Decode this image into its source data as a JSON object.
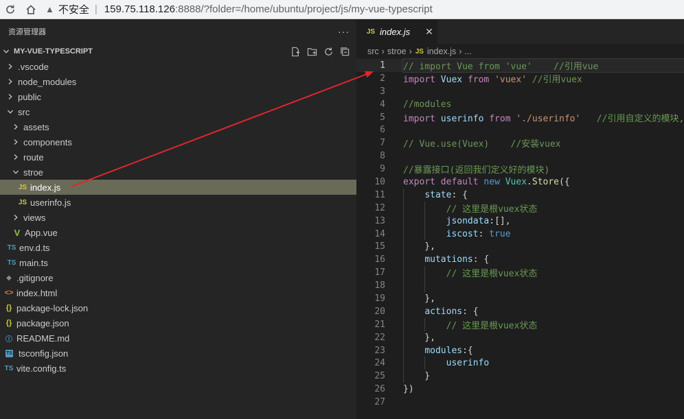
{
  "browser": {
    "warning_text": "不安全",
    "separator": "|",
    "url_host": "159.75.118.126",
    "url_rest": ":8888/?folder=/home/ubuntu/project/js/my-vue-typescript"
  },
  "explorer": {
    "title": "资源管理器",
    "more": "···",
    "project": "MY-VUE-TYPESCRIPT",
    "items": [
      {
        "label": ".vscode",
        "type": "folder",
        "expanded": false,
        "indent": 0
      },
      {
        "label": "node_modules",
        "type": "folder",
        "expanded": false,
        "indent": 0
      },
      {
        "label": "public",
        "type": "folder",
        "expanded": false,
        "indent": 0
      },
      {
        "label": "src",
        "type": "folder",
        "expanded": true,
        "indent": 0
      },
      {
        "label": "assets",
        "type": "folder",
        "expanded": false,
        "indent": 1
      },
      {
        "label": "components",
        "type": "folder",
        "expanded": false,
        "indent": 1
      },
      {
        "label": "route",
        "type": "folder",
        "expanded": false,
        "indent": 1
      },
      {
        "label": "stroe",
        "type": "folder",
        "expanded": true,
        "indent": 1
      },
      {
        "label": "index.js",
        "type": "js",
        "indent": 2,
        "selected": true
      },
      {
        "label": "userinfo.js",
        "type": "js",
        "indent": 2
      },
      {
        "label": "views",
        "type": "folder",
        "expanded": false,
        "indent": 1
      },
      {
        "label": "App.vue",
        "type": "vue",
        "indent": 1
      },
      {
        "label": "env.d.ts",
        "type": "ts",
        "indent": 0
      },
      {
        "label": "main.ts",
        "type": "ts",
        "indent": 0
      },
      {
        "label": ".gitignore",
        "type": "git",
        "indent": -1
      },
      {
        "label": "index.html",
        "type": "html",
        "indent": -1
      },
      {
        "label": "package-lock.json",
        "type": "json",
        "indent": -1
      },
      {
        "label": "package.json",
        "type": "json",
        "indent": -1
      },
      {
        "label": "README.md",
        "type": "info",
        "indent": -1
      },
      {
        "label": "tsconfig.json",
        "type": "tscfg",
        "indent": -1
      },
      {
        "label": "vite.config.ts",
        "type": "ts",
        "indent": -1
      }
    ]
  },
  "editor": {
    "tab_label": "index.js",
    "tab_icon": "JS",
    "breadcrumb": [
      "src",
      "stroe",
      "index.js",
      "..."
    ],
    "current_line": 1,
    "lines": [
      [
        [
          "// import Vue from 'vue'    //引用vue",
          "cm"
        ]
      ],
      [
        [
          "import",
          "kw"
        ],
        [
          " Vuex ",
          "prop"
        ],
        [
          "from",
          "kw"
        ],
        [
          " ",
          "pl"
        ],
        [
          "'vuex'",
          "str"
        ],
        [
          " //引用vuex",
          "cm"
        ]
      ],
      [],
      [
        [
          "//modules",
          "cm"
        ]
      ],
      [
        [
          "import",
          "kw"
        ],
        [
          " userinfo ",
          "prop"
        ],
        [
          "from",
          "kw"
        ],
        [
          " ",
          "pl"
        ],
        [
          "'./userinfo'",
          "str"
        ],
        [
          "   //引用自定义的模块,",
          "cm"
        ]
      ],
      [],
      [
        [
          "// Vue.use(Vuex)    //安装vuex",
          "cm"
        ]
      ],
      [],
      [
        [
          "//暴露接口(返回我们定义好的模块)",
          "cm"
        ]
      ],
      [
        [
          "export",
          "kw"
        ],
        [
          " ",
          "pl"
        ],
        [
          "default",
          "kw"
        ],
        [
          " ",
          "pl"
        ],
        [
          "new",
          "kw2"
        ],
        [
          " ",
          "pl"
        ],
        [
          "Vuex",
          "cls"
        ],
        [
          ".",
          "pl"
        ],
        [
          "Store",
          "fn"
        ],
        [
          "({",
          "pl"
        ]
      ],
      [
        [
          "    ",
          "pl"
        ],
        [
          "state",
          "prop"
        ],
        [
          ": {",
          "pl"
        ]
      ],
      [
        [
          "        ",
          "pl"
        ],
        [
          "// 这里是根vuex状态",
          "cm"
        ]
      ],
      [
        [
          "        ",
          "pl"
        ],
        [
          "jsondata",
          "prop"
        ],
        [
          ":[],",
          "pl"
        ]
      ],
      [
        [
          "        ",
          "pl"
        ],
        [
          "iscost",
          "prop"
        ],
        [
          ": ",
          "pl"
        ],
        [
          "true",
          "kw2"
        ]
      ],
      [
        [
          "    },",
          "pl"
        ]
      ],
      [
        [
          "    ",
          "pl"
        ],
        [
          "mutations",
          "prop"
        ],
        [
          ": {",
          "pl"
        ]
      ],
      [
        [
          "        ",
          "pl"
        ],
        [
          "// 这里是根vuex状态",
          "cm"
        ]
      ],
      [],
      [
        [
          "    },",
          "pl"
        ]
      ],
      [
        [
          "    ",
          "pl"
        ],
        [
          "actions",
          "prop"
        ],
        [
          ": {",
          "pl"
        ]
      ],
      [
        [
          "        ",
          "pl"
        ],
        [
          "// 这里是根vuex状态",
          "cm"
        ]
      ],
      [
        [
          "    },",
          "pl"
        ]
      ],
      [
        [
          "    ",
          "pl"
        ],
        [
          "modules",
          "prop"
        ],
        [
          ":{",
          "pl"
        ]
      ],
      [
        [
          "        ",
          "pl"
        ],
        [
          "userinfo",
          "prop"
        ]
      ],
      [
        [
          "    }",
          "pl"
        ]
      ],
      [
        [
          "})",
          "pl"
        ]
      ],
      []
    ]
  },
  "colors": {
    "annotation_arrow": "#e0262a",
    "selected_row": "#6a6a59"
  }
}
